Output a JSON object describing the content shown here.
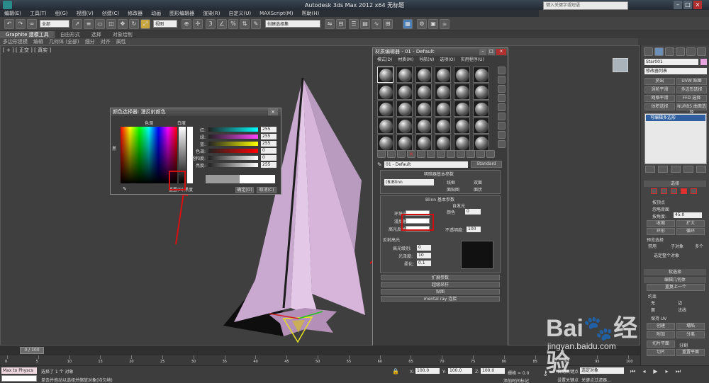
{
  "app": {
    "title": "Autodesk 3ds Max  2012 x64      无标题",
    "search_placeholder": "键入关键字或短语"
  },
  "menu": [
    "编辑(E)",
    "工具(T)",
    "组(G)",
    "视图(V)",
    "创建(C)",
    "修改器",
    "动画",
    "图形编辑器",
    "渲染(R)",
    "自定义(U)",
    "MAXScript(M)",
    "帮助(H)"
  ],
  "toolbar": {
    "selection_filter": "全部",
    "ref_coord": "视图",
    "named_selection": "创建选择集"
  },
  "ribbon": {
    "tabs": [
      "Graphite 建模工具",
      "自由形式",
      "选择",
      "对象绘制"
    ],
    "subtabs": [
      "多边形建模",
      "编辑",
      "几何体 (全部)",
      "细分",
      "对齐",
      "属性"
    ]
  },
  "viewport": {
    "label": "[ + ] [ 正交 ] [ 真实 ]"
  },
  "color_picker": {
    "title": "颜色选择器: 漫反射颜色",
    "hue_label": "色调",
    "whiteness_label": "白度",
    "black_label": "黑",
    "black_label_bottom": "黑度",
    "channels": [
      {
        "label": "红:",
        "value": "255",
        "color": "#00ffff"
      },
      {
        "label": "绿:",
        "value": "255",
        "color": "#ff44ff"
      },
      {
        "label": "蓝:",
        "value": "255",
        "color": "#ffff00"
      },
      {
        "label": "色调:",
        "value": "0",
        "color": "#ff0000"
      },
      {
        "label": "饱和度:",
        "value": "0",
        "color": "#ffffff"
      },
      {
        "label": "亮度:",
        "value": "255",
        "color": "#ffffff"
      }
    ],
    "reset_label": "重置(R)",
    "ok_label": "确定(O)",
    "cancel_label": "取消(C)"
  },
  "material_editor": {
    "title": "材质编辑器 - 01 - Default",
    "menu": [
      "模式(D)",
      "材质(M)",
      "导航(N)",
      "选项(O)",
      "实用程序(U)"
    ],
    "material_name": "01 - Default",
    "material_type": "Standard",
    "rollouts": {
      "shader_basic": "明暗器基本参数",
      "shader_type": "(B)Blinn",
      "wire": "线框",
      "two_sided": "双面",
      "face_map": "面贴图",
      "faceted": "面状",
      "blinn_basic": "Blinn 基本参数",
      "self_illum": "自发光",
      "color": "颜色",
      "color_value": "0",
      "ambient": "环境光:",
      "diffuse": "漫反射:",
      "specular": "高光反射:",
      "opacity": "不透明度:",
      "opacity_value": "100",
      "specular_highlights": "反射高光",
      "spec_level": "高光级别:",
      "spec_level_value": "0",
      "glossiness": "光泽度:",
      "glossiness_value": "10",
      "soften": "柔化:",
      "soften_value": "0.1",
      "extended": "扩展参数",
      "supersampling": "超级采样",
      "maps": "贴图",
      "mental_ray": "mental ray 连接"
    }
  },
  "command_panel": {
    "object_name": "Star001",
    "modifier_list": "修改器列表",
    "buttons": [
      "挤出",
      "UVW 贴图",
      "涡轮平滑",
      "多边形选择",
      "网格平滑",
      "FFD 选择",
      "体积选择",
      "NURBS 曲面选择"
    ],
    "stack_item": "可编辑多边形",
    "select_rollout": "选择",
    "by_vertex": "按顶点",
    "ignore_back": "忽略背面",
    "by_angle": "按角度:",
    "angle_value": "45.0",
    "shrink": "收缩",
    "grow": "扩大",
    "ring": "环形",
    "loop": "循环",
    "preview_selection": "预览选择",
    "disabled": "禁用",
    "subobject": "子对象",
    "multi": "多个",
    "selected_entire": "选定整个对象",
    "soft_selection": "软选择",
    "edit_geometry": "编辑几何体",
    "repeat_last": "重复上一个",
    "constraints": "约束",
    "none": "无",
    "edge": "边",
    "face": "面",
    "normal": "法线",
    "preserve_uv": "保持 UV",
    "create": "创建",
    "collapse": "塌陷",
    "attach": "附加",
    "detach": "分离",
    "slice_plane": "切片平面",
    "split": "分割",
    "slice": "切片",
    "reset_plane": "重置平面"
  },
  "timeline": {
    "frame": "0 / 100",
    "ticks": [
      "0",
      "5",
      "10",
      "15",
      "20",
      "25",
      "30",
      "35",
      "40",
      "45",
      "50",
      "55",
      "60",
      "65",
      "70",
      "75",
      "80",
      "85",
      "90",
      "95",
      "100"
    ]
  },
  "status": {
    "script_field": "Max to Physcs",
    "selected": "选择了 1 个 对象",
    "prompt": "单击并拖动以选择并缩放对象(均匀地)",
    "x_label": "X:",
    "x_value": "100.0",
    "y_label": "Y:",
    "y_value": "100.0",
    "z_label": "Z:",
    "z_value": "100.0",
    "grid": "栅格 = 0.0",
    "add_time_tag": "添加时间标记",
    "auto_key": "自动关键点",
    "set_key": "设置关键点",
    "selected_object": "选定对象",
    "key_filters": "关键点过滤器..."
  },
  "watermark": {
    "site": "jingyan.baidu.com"
  }
}
